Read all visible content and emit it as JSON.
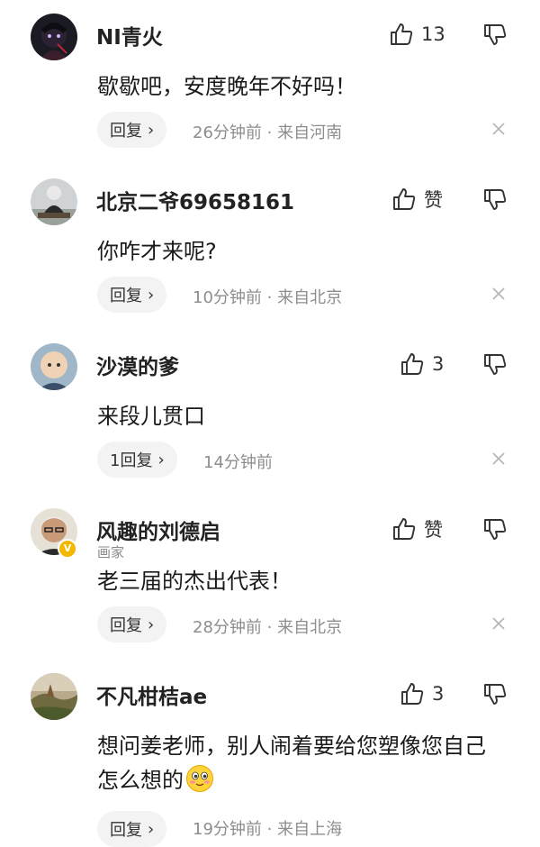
{
  "comments": [
    {
      "avatar": "avatar-dark-anime",
      "name": "NI青火",
      "subtitle": "",
      "likes": "13",
      "text": "歇歇吧，安度晚年不好吗！",
      "reply_label": "回复",
      "time": "26分钟前",
      "location": "· 来自河南"
    },
    {
      "avatar": "avatar-elder-sitting",
      "name": "北京二爷69658161",
      "subtitle": "",
      "likes": "赞",
      "text": "你咋才来呢?",
      "reply_label": "回复",
      "time": "10分钟前",
      "location": "· 来自北京"
    },
    {
      "avatar": "avatar-child",
      "name": "沙漠的爹",
      "subtitle": "",
      "likes": "3",
      "text": "来段儿贯口",
      "reply_label": "1回复",
      "time": "14分钟前",
      "location": ""
    },
    {
      "avatar": "avatar-old-man",
      "name": "风趣的刘德启",
      "subtitle": "画家",
      "verified": "V",
      "likes": "赞",
      "text": "老三届的杰出代表！",
      "reply_label": "回复",
      "time": "28分钟前",
      "location": "· 来自北京"
    },
    {
      "avatar": "avatar-landscape",
      "name": "不凡柑桔ae",
      "subtitle": "",
      "likes": "3",
      "text": "想问姜老师，别人闹着要给您塑像您自己怎么想的",
      "reply_label": "回复",
      "time": "19分钟前",
      "location": "· 来自上海"
    }
  ],
  "colors": {
    "text": "#1a1a1a",
    "meta": "#8d8d8d",
    "reply_bg": "#f3f3f3",
    "badge": "#f5b800"
  }
}
